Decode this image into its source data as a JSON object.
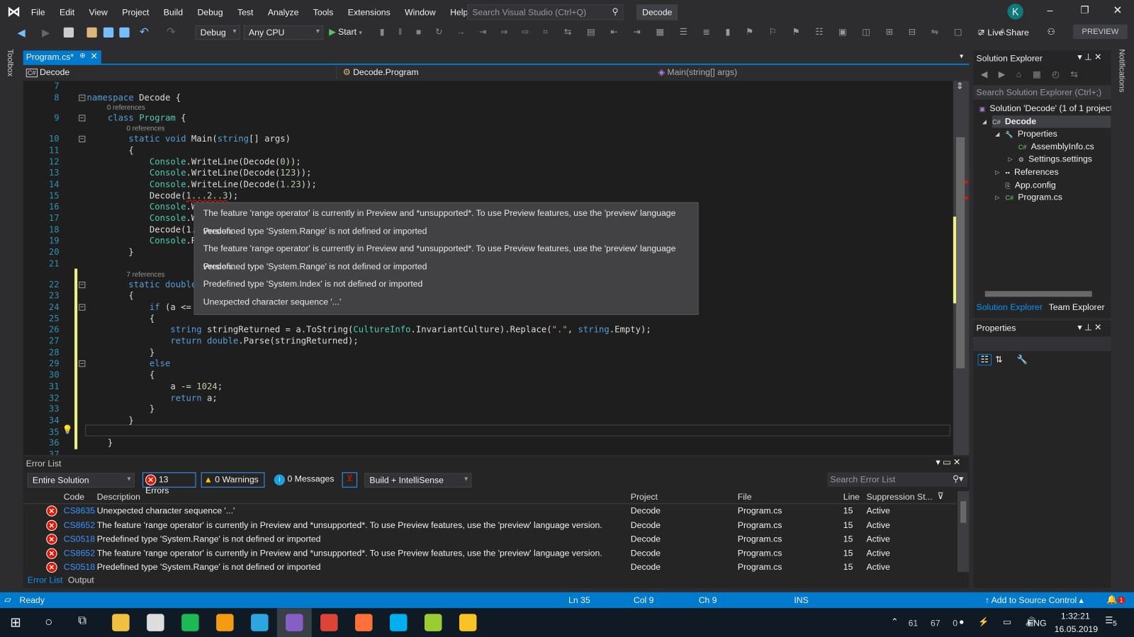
{
  "menu": {
    "items": [
      "File",
      "Edit",
      "View",
      "Project",
      "Build",
      "Debug",
      "Test",
      "Analyze",
      "Tools",
      "Extensions",
      "Window",
      "Help"
    ],
    "search_placeholder": "Search Visual Studio (Ctrl+Q)",
    "solution_name": "Decode",
    "avatar": "K"
  },
  "toolbar": {
    "config": "Debug",
    "platform": "Any CPU",
    "start": "Start",
    "live_share": "Live Share",
    "preview": "PREVIEW"
  },
  "side": {
    "toolbox": "Toolbox",
    "notifications": "Notifications"
  },
  "editor": {
    "tab": "Program.cs*",
    "nav_project": "Decode",
    "nav_class": "Decode.Program",
    "nav_member": "Main(string[] args)",
    "lines": [
      {
        "n": "7",
        "t": []
      },
      {
        "n": "8",
        "t": [
          [
            "kw",
            "namespace"
          ],
          [
            "tx",
            " Decode {"
          ]
        ]
      },
      {
        "lens": "0 references"
      },
      {
        "n": "9",
        "t": [
          [
            "tx",
            "    "
          ],
          [
            "kw",
            "class"
          ],
          [
            "tx",
            " "
          ],
          [
            "ty",
            "Program"
          ],
          [
            "tx",
            " {"
          ]
        ]
      },
      {
        "lens": "0 references"
      },
      {
        "n": "10",
        "t": [
          [
            "tx",
            "        "
          ],
          [
            "kw",
            "static void"
          ],
          [
            "tx",
            " Main("
          ],
          [
            "kw",
            "string"
          ],
          [
            "tx",
            "[] args)"
          ]
        ]
      },
      {
        "n": "11",
        "t": [
          [
            "tx",
            "        {"
          ]
        ]
      },
      {
        "n": "12",
        "t": [
          [
            "tx",
            "            "
          ],
          [
            "ty",
            "Console"
          ],
          [
            "tx",
            ".WriteLine(Decode("
          ],
          [
            "nm",
            "0"
          ],
          [
            "tx",
            "));"
          ]
        ]
      },
      {
        "n": "13",
        "t": [
          [
            "tx",
            "            "
          ],
          [
            "ty",
            "Console"
          ],
          [
            "tx",
            ".WriteLine(Decode("
          ],
          [
            "nm",
            "123"
          ],
          [
            "tx",
            "));"
          ]
        ]
      },
      {
        "n": "14",
        "t": [
          [
            "tx",
            "            "
          ],
          [
            "ty",
            "Console"
          ],
          [
            "tx",
            ".WriteLine(Decode("
          ],
          [
            "nm",
            "1.23"
          ],
          [
            "tx",
            "));"
          ]
        ]
      },
      {
        "n": "15",
        "t": [
          [
            "tx",
            "            Decode("
          ],
          [
            "nm",
            "1...2..3"
          ],
          [
            "tx",
            ");"
          ]
        ]
      },
      {
        "n": "16",
        "t": [
          [
            "tx",
            "            "
          ],
          [
            "ty",
            "Console"
          ],
          [
            "tx",
            ".Wr"
          ]
        ]
      },
      {
        "n": "17",
        "t": [
          [
            "tx",
            "            "
          ],
          [
            "ty",
            "Console"
          ],
          [
            "tx",
            ".Wr"
          ]
        ]
      },
      {
        "n": "18",
        "t": [
          [
            "tx",
            "            Decode(1.."
          ]
        ]
      },
      {
        "n": "19",
        "t": [
          [
            "tx",
            "            "
          ],
          [
            "ty",
            "Console"
          ],
          [
            "tx",
            ".Re"
          ]
        ]
      },
      {
        "n": "20",
        "t": [
          [
            "tx",
            "        }"
          ]
        ]
      },
      {
        "n": "21",
        "t": []
      },
      {
        "lens": "7 references"
      },
      {
        "n": "22",
        "t": [
          [
            "tx",
            "        "
          ],
          [
            "kw",
            "static double"
          ]
        ]
      },
      {
        "n": "23",
        "t": [
          [
            "tx",
            "        {"
          ]
        ]
      },
      {
        "n": "24",
        "t": [
          [
            "tx",
            "            "
          ],
          [
            "kw",
            "if"
          ],
          [
            "tx",
            " (a <= 1"
          ]
        ]
      },
      {
        "n": "25",
        "t": [
          [
            "tx",
            "            {"
          ]
        ]
      },
      {
        "n": "26",
        "t": [
          [
            "tx",
            "                "
          ],
          [
            "kw",
            "string"
          ],
          [
            "tx",
            " stringReturned = a.ToString("
          ],
          [
            "ty",
            "CultureInfo"
          ],
          [
            "tx",
            ".InvariantCulture).Replace("
          ],
          [
            "st",
            "\".\""
          ],
          [
            "tx",
            ", "
          ],
          [
            "kw",
            "string"
          ],
          [
            "tx",
            ".Empty);"
          ]
        ]
      },
      {
        "n": "27",
        "t": [
          [
            "tx",
            "                "
          ],
          [
            "kw",
            "return double"
          ],
          [
            "tx",
            ".Parse(stringReturned);"
          ]
        ]
      },
      {
        "n": "28",
        "t": [
          [
            "tx",
            "            }"
          ]
        ]
      },
      {
        "n": "29",
        "t": [
          [
            "tx",
            "            "
          ],
          [
            "kw",
            "else"
          ]
        ]
      },
      {
        "n": "30",
        "t": [
          [
            "tx",
            "            {"
          ]
        ]
      },
      {
        "n": "31",
        "t": [
          [
            "tx",
            "                a -= "
          ],
          [
            "nm",
            "1024"
          ],
          [
            "tx",
            ";"
          ]
        ]
      },
      {
        "n": "32",
        "t": [
          [
            "tx",
            "                "
          ],
          [
            "kw",
            "return"
          ],
          [
            "tx",
            " a;"
          ]
        ]
      },
      {
        "n": "33",
        "t": [
          [
            "tx",
            "            }"
          ]
        ]
      },
      {
        "n": "34",
        "t": [
          [
            "tx",
            "        }"
          ]
        ]
      },
      {
        "n": "35",
        "t": []
      },
      {
        "n": "36",
        "t": [
          [
            "tx",
            "    }"
          ]
        ]
      },
      {
        "n": "37",
        "t": []
      }
    ],
    "tooltip": [
      "The feature 'range operator' is currently in Preview and *unsupported*. To use Preview features, use the 'preview' language version.",
      "Predefined type 'System.Range' is not defined or imported",
      "The feature 'range operator' is currently in Preview and *unsupported*. To use Preview features, use the 'preview' language version.",
      "Predefined type 'System.Range' is not defined or imported",
      "Predefined type 'System.Index' is not defined or imported",
      "Unexpected character sequence '...'"
    ]
  },
  "solution_explorer": {
    "title": "Solution Explorer",
    "search_placeholder": "Search Solution Explorer (Ctrl+;)",
    "tree": [
      {
        "label": "Solution 'Decode' (1 of 1 project)",
        "indent": 0,
        "icon": "solution-icon"
      },
      {
        "label": "Decode",
        "indent": 1,
        "icon": "csharp-project-icon",
        "bold": true,
        "arrow": "◢"
      },
      {
        "label": "Properties",
        "indent": 2,
        "icon": "wrench-icon",
        "arrow": "◢"
      },
      {
        "label": "AssemblyInfo.cs",
        "indent": 3,
        "icon": "csharp-file-icon"
      },
      {
        "label": "Settings.settings",
        "indent": 3,
        "icon": "gear-icon",
        "arrow": "▷"
      },
      {
        "label": "References",
        "indent": 2,
        "icon": "references-icon",
        "arrow": "▷"
      },
      {
        "label": "App.config",
        "indent": 2,
        "icon": "config-icon"
      },
      {
        "label": "Program.cs",
        "indent": 2,
        "icon": "csharp-file-icon",
        "arrow": "▷"
      }
    ],
    "tabs": [
      "Solution Explorer",
      "Team Explorer"
    ]
  },
  "properties": {
    "title": "Properties"
  },
  "error_list": {
    "title": "Error List",
    "scope": "Entire Solution",
    "errors": "13 Errors",
    "warnings": "0 Warnings",
    "messages": "0 Messages",
    "source": "Build + IntelliSense",
    "search_placeholder": "Search Error List",
    "columns": [
      "Code",
      "Description",
      "Project",
      "File",
      "Line",
      "Suppression St..."
    ],
    "rows": [
      {
        "code": "CS8635",
        "desc": "Unexpected character sequence '...'",
        "project": "Decode",
        "file": "Program.cs",
        "line": "15",
        "state": "Active"
      },
      {
        "code": "CS8652",
        "desc": "The feature 'range operator' is currently in Preview and *unsupported*. To use Preview features, use the 'preview' language version.",
        "project": "Decode",
        "file": "Program.cs",
        "line": "15",
        "state": "Active"
      },
      {
        "code": "CS0518",
        "desc": "Predefined type 'System.Range' is not defined or imported",
        "project": "Decode",
        "file": "Program.cs",
        "line": "15",
        "state": "Active"
      },
      {
        "code": "CS8652",
        "desc": "The feature 'range operator' is currently in Preview and *unsupported*. To use Preview features, use the 'preview' language version.",
        "project": "Decode",
        "file": "Program.cs",
        "line": "15",
        "state": "Active"
      },
      {
        "code": "CS0518",
        "desc": "Predefined type 'System.Range' is not defined or imported",
        "project": "Decode",
        "file": "Program.cs",
        "line": "15",
        "state": "Active"
      }
    ],
    "bottom_tabs": [
      "Error List",
      "Output"
    ]
  },
  "status": {
    "ready": "Ready",
    "ln": "Ln 35",
    "col": "Col 9",
    "ch": "Ch 9",
    "mode": "INS",
    "source_control": "Add to Source Control",
    "notif_count": "1"
  },
  "taskbar": {
    "tray": [
      "61",
      "67",
      "0"
    ],
    "lang": "ENG",
    "time": "1:32:21",
    "date": "16.05.2019",
    "notif": "5",
    "apps": [
      {
        "name": "file-explorer-icon",
        "color": "#f0c040"
      },
      {
        "name": "calculator-icon",
        "color": "#ddd"
      },
      {
        "name": "spotify-icon",
        "color": "#1db954"
      },
      {
        "name": "music-player-icon",
        "color": "#f39c12"
      },
      {
        "name": "telegram-icon",
        "color": "#2ca5e0"
      },
      {
        "name": "visual-studio-icon",
        "color": "#865fc5"
      },
      {
        "name": "chrome-icon",
        "color": "#db4437"
      },
      {
        "name": "firefox-icon",
        "color": "#ff7139"
      },
      {
        "name": "skype-icon",
        "color": "#00aff0"
      },
      {
        "name": "notepad-icon",
        "color": "#9acd32"
      },
      {
        "name": "keep-icon",
        "color": "#f7c325"
      }
    ]
  },
  "colors": {
    "accent": "#007acc",
    "error": "#e51400",
    "warning": "#ffcc00",
    "info": "#1ba1e2",
    "editor_bg": "#1e1e1e"
  }
}
